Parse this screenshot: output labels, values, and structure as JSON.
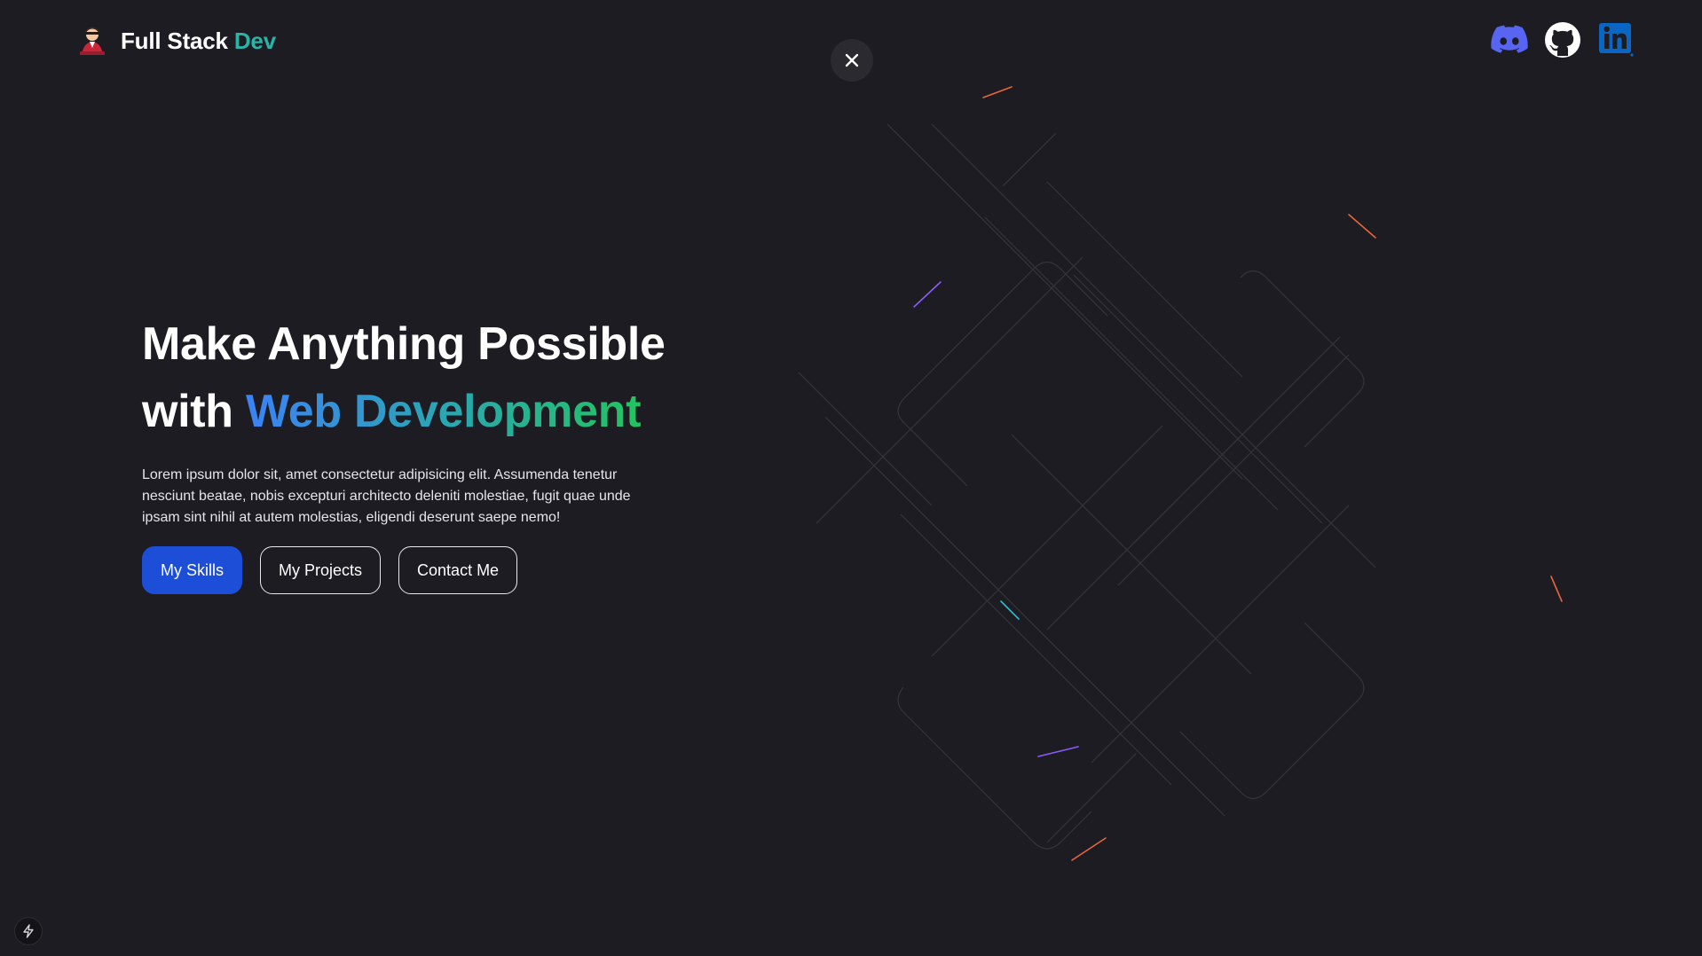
{
  "brand": {
    "name": "Full Stack",
    "accent": "Dev",
    "accent_color": "#2bb3a8",
    "avatar_icon": "developer-avatar-icon"
  },
  "close_icon": "close-icon",
  "socials": [
    {
      "icon": "discord-icon",
      "color": "#5865F2"
    },
    {
      "icon": "github-icon",
      "color": "#ffffff"
    },
    {
      "icon": "linkedin-icon",
      "color": "#0a66c2"
    }
  ],
  "hero": {
    "title_line1": "Make Anything Possible",
    "title_line2_prefix": "with",
    "title_line2_highlight": "Web Development",
    "gradient": [
      "#3b82f6",
      "#22c55e"
    ],
    "description": "Lorem ipsum dolor sit, amet consectetur adipisicing elit. Assumenda tenetur nesciunt beatae, nobis excepturi architecto deleniti molestiae, fugit quae unde ipsam sint nihil at autem molestias, eligendi deserunt saepe nemo!",
    "buttons": {
      "skills": "My Skills",
      "projects": "My Projects",
      "contact": "Contact Me"
    },
    "primary_color": "#1d4ed8"
  },
  "background_color": "#1d1c22",
  "dev_indicator_icon": "bolt-icon"
}
